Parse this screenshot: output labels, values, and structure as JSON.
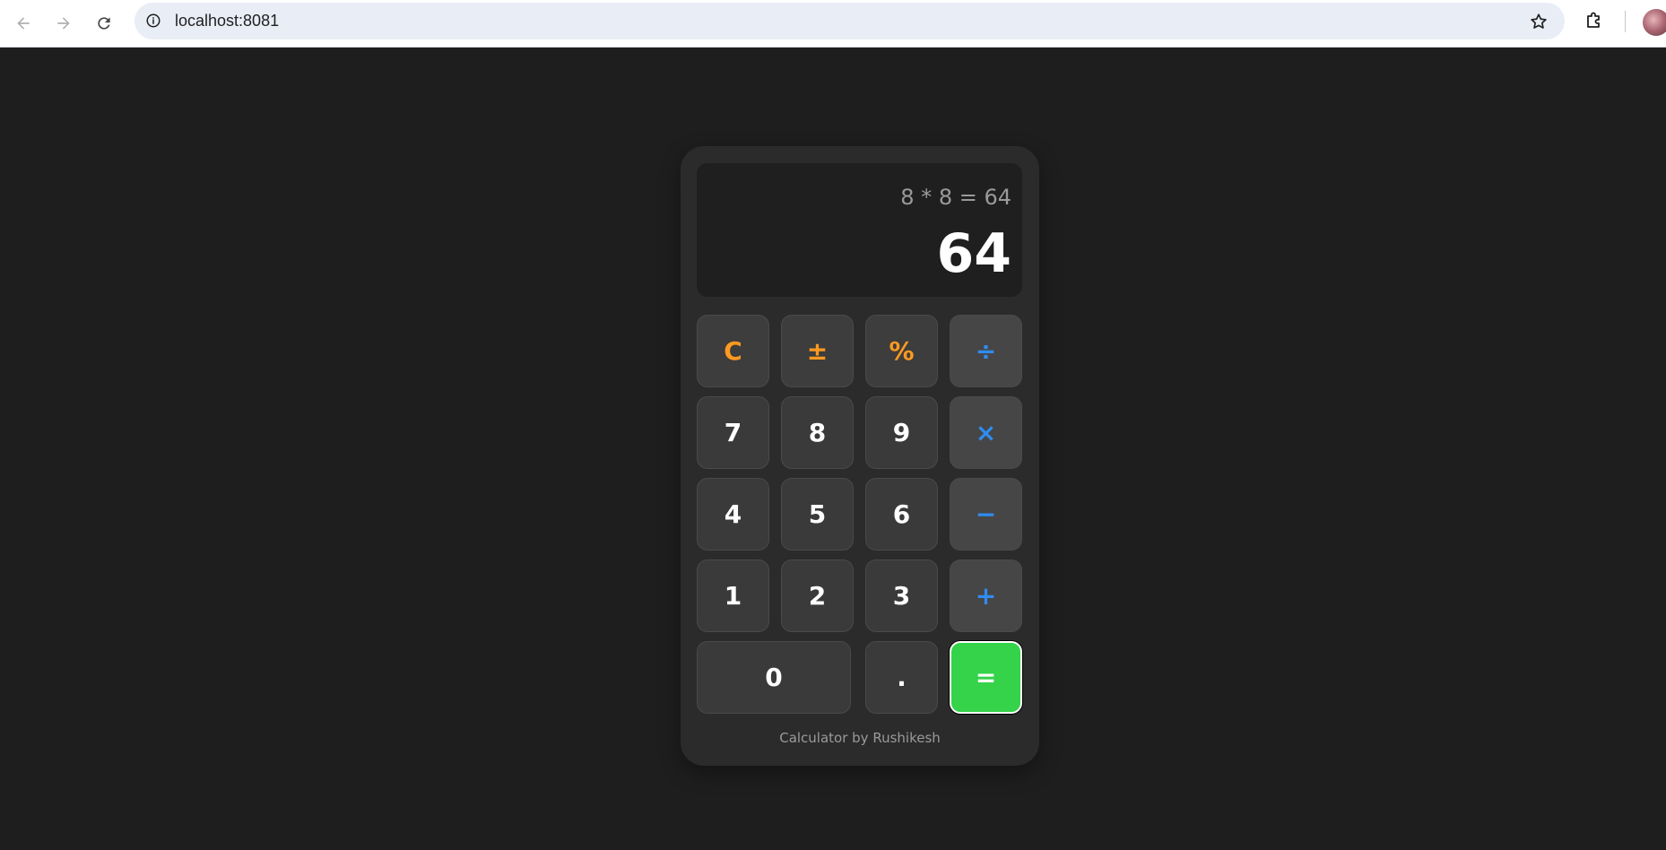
{
  "browser": {
    "url": "localhost:8081"
  },
  "display": {
    "expression": "8 * 8 = 64",
    "result": "64"
  },
  "keys": {
    "clear": "C",
    "sign": "±",
    "percent": "%",
    "divide": "÷",
    "seven": "7",
    "eight": "8",
    "nine": "9",
    "multiply": "×",
    "four": "4",
    "five": "5",
    "six": "6",
    "subtract": "−",
    "one": "1",
    "two": "2",
    "three": "3",
    "add": "+",
    "zero": "0",
    "decimal": ".",
    "equals": "="
  },
  "footer": {
    "text": "Calculator by Rushikesh"
  },
  "colors": {
    "background": "#1e1e1e",
    "calculator_body": "#2b2b2b",
    "key": "#3a3a3a",
    "function_key_text": "#ff9a1f",
    "operator_key_text": "#2f8cf0",
    "equals_key": "#34d34a"
  }
}
